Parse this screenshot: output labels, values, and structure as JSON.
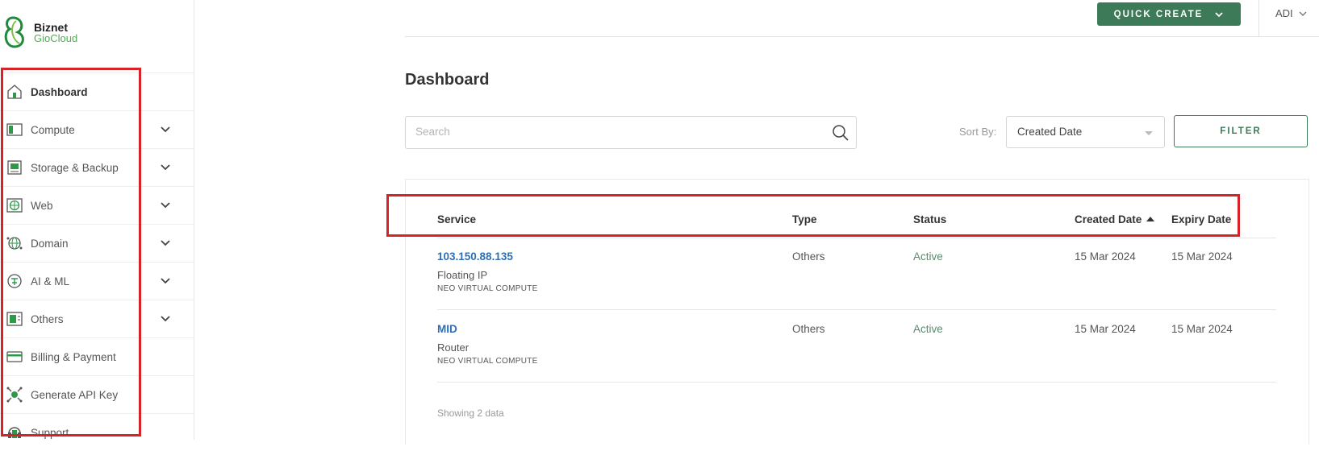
{
  "brand": {
    "line1": "Biznet",
    "line2": "GioCloud"
  },
  "sidebar": {
    "items": [
      {
        "label": "Dashboard",
        "icon": "home-icon",
        "expandable": false,
        "active": true
      },
      {
        "label": "Compute",
        "icon": "compute-icon",
        "expandable": true
      },
      {
        "label": "Storage & Backup",
        "icon": "storage-icon",
        "expandable": true
      },
      {
        "label": "Web",
        "icon": "web-icon",
        "expandable": true
      },
      {
        "label": "Domain",
        "icon": "domain-icon",
        "expandable": true
      },
      {
        "label": "AI & ML",
        "icon": "ai-icon",
        "expandable": true
      },
      {
        "label": "Others",
        "icon": "others-icon",
        "expandable": true
      },
      {
        "label": "Billing & Payment",
        "icon": "billing-icon",
        "expandable": false
      },
      {
        "label": "Generate API Key",
        "icon": "api-key-icon",
        "expandable": false
      },
      {
        "label": "Support",
        "icon": "support-icon",
        "expandable": false
      }
    ]
  },
  "header": {
    "quick_create": "QUICK CREATE",
    "user": "ADI"
  },
  "page": {
    "title": "Dashboard"
  },
  "search": {
    "placeholder": "Search",
    "value": ""
  },
  "sort": {
    "label": "Sort By:",
    "value": "Created Date"
  },
  "filter": {
    "label": "FILTER"
  },
  "table": {
    "columns": {
      "service": "Service",
      "type": "Type",
      "status": "Status",
      "created": "Created Date",
      "expiry": "Expiry Date"
    },
    "rows": [
      {
        "service": "103.150.88.135",
        "kind": "Floating IP",
        "product": "NEO VIRTUAL COMPUTE",
        "type": "Others",
        "status": "Active",
        "created": "15 Mar 2024",
        "expiry": "15 Mar 2024"
      },
      {
        "service": "MID",
        "kind": "Router",
        "product": "NEO VIRTUAL COMPUTE",
        "type": "Others",
        "status": "Active",
        "created": "15 Mar 2024",
        "expiry": "15 Mar 2024"
      }
    ],
    "footer": "Showing 2 data"
  },
  "colors": {
    "accent": "#3c7a58",
    "link": "#2f6fb5",
    "highlight": "#d6232a"
  }
}
